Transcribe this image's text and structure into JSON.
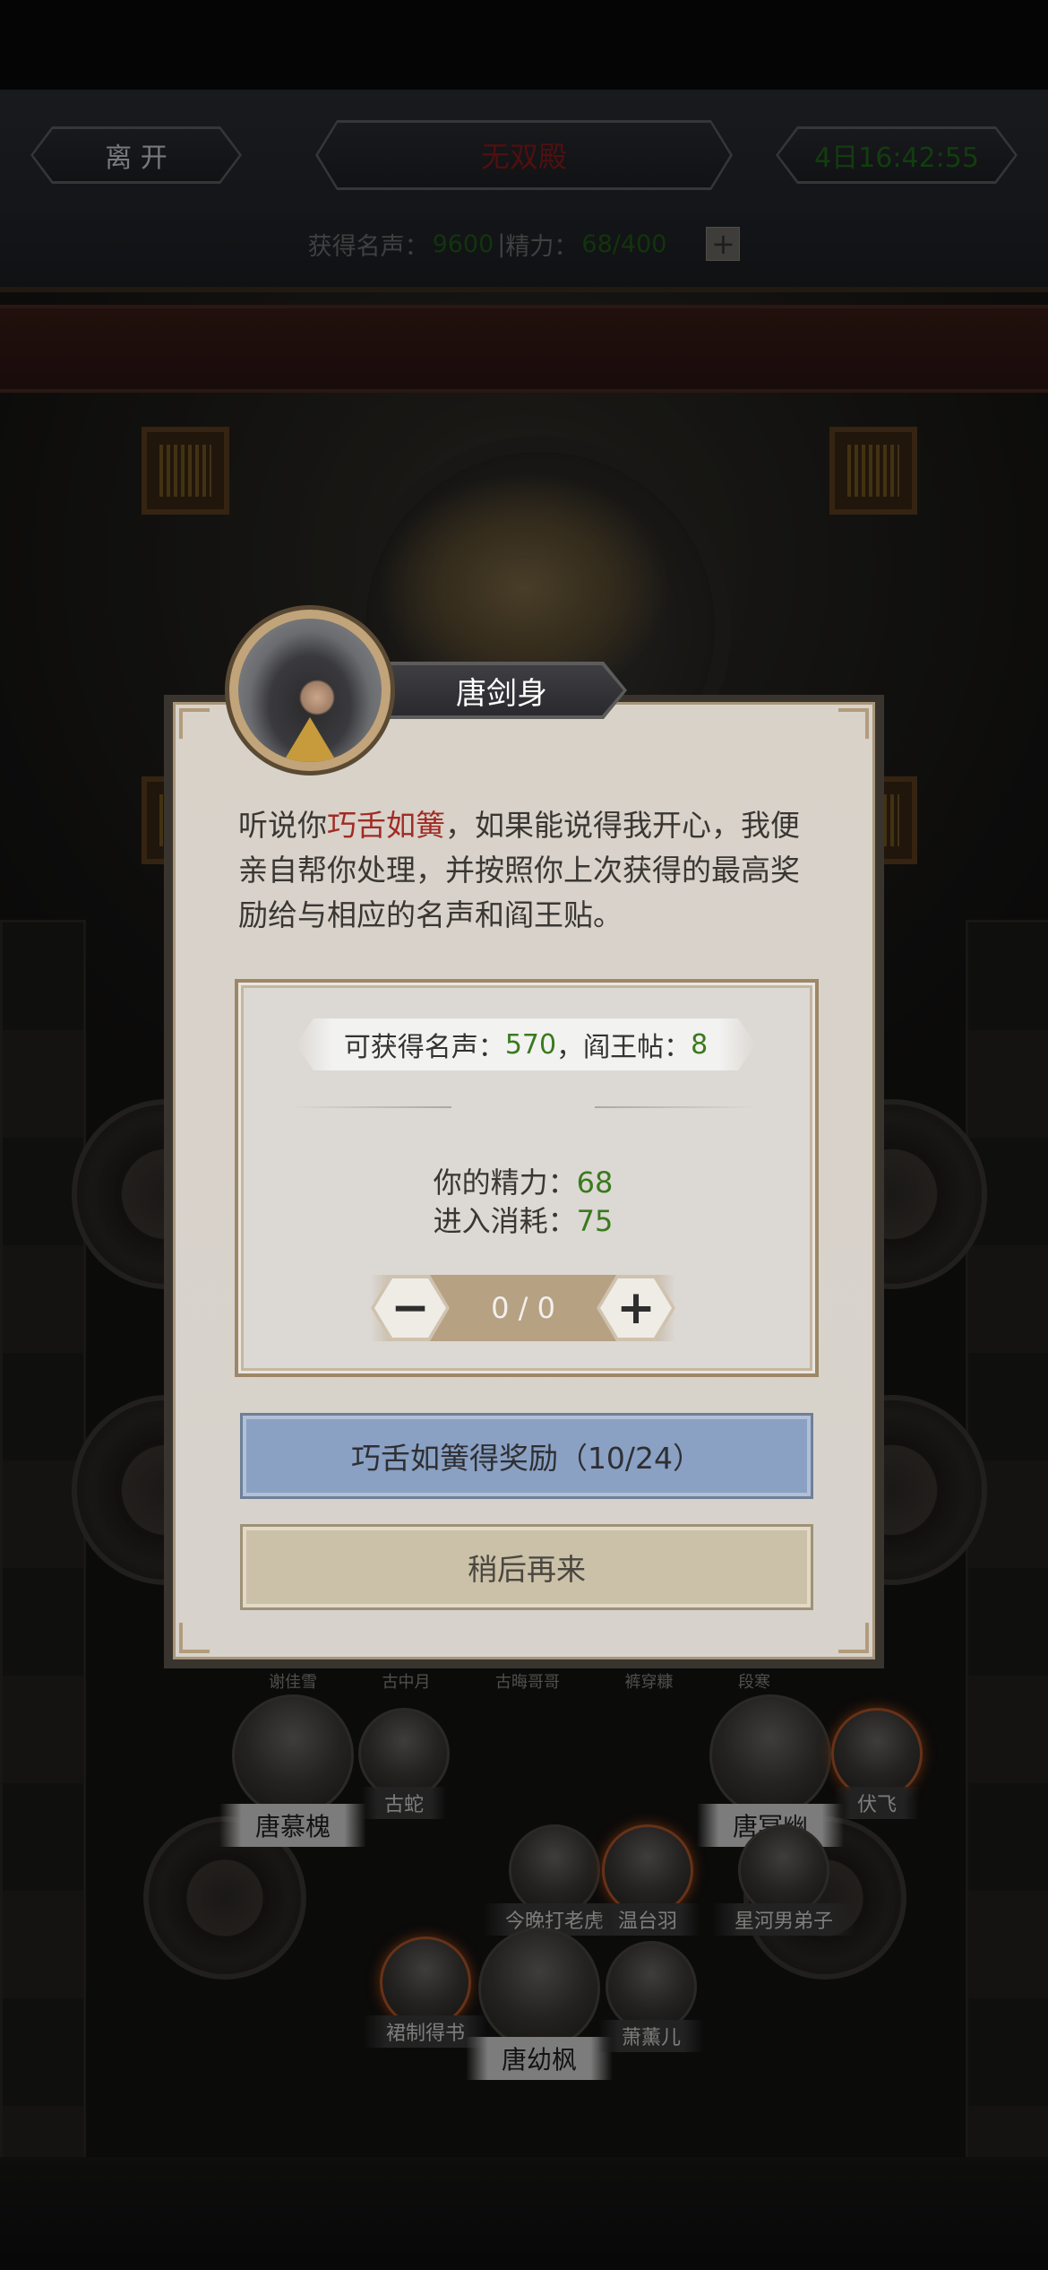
{
  "header": {
    "leave_label": "离 开",
    "title": "无双殿",
    "timer": "4日16:42:55",
    "fame_label": "获得名声：",
    "fame_value": "9600",
    "separator": "|",
    "energy_label": "精力：",
    "energy_value": "68/400",
    "add_symbol": "+"
  },
  "dialog": {
    "npc_name": "唐剑身",
    "text_before": "听说你",
    "text_highlight": "巧舌如簧",
    "text_after": "，如果能说得我开心，我便亲自帮你处理，并按照你上次获得的最高奖励给与相应的名声和阎王贴。",
    "reward_fame_label": "可获得名声：",
    "reward_fame_value": "570",
    "reward_sep": "，",
    "reward_ticket_label": "阎王帖：",
    "reward_ticket_value": "8",
    "energy_label": "你的精力：",
    "energy_value": "68",
    "cost_label": "进入消耗：",
    "cost_value": "75",
    "stepper_value": "0 / 0",
    "minus_symbol": "−",
    "plus_symbol": "+",
    "reward_button": "巧舌如簧得奖励（10/24）",
    "later_button": "稍后再来"
  },
  "scene": {
    "top_row_names": [
      "谢佳雪",
      "古中月",
      "古晦哥哥",
      "裤穿糠",
      "段寒"
    ],
    "characters": [
      {
        "name": "唐慕槐"
      },
      {
        "name": "古蛇"
      },
      {
        "name": "唐冥幽"
      },
      {
        "name": "伏飞"
      },
      {
        "name": "今晚打老虎"
      },
      {
        "name": "温台羽"
      },
      {
        "name": "星河男弟子"
      },
      {
        "name": "裙制得书"
      },
      {
        "name": "唐幼枫"
      },
      {
        "name": "萧薰儿"
      }
    ]
  },
  "colors": {
    "highlight_red": "#a22a24",
    "value_green": "#3a7a1e",
    "reward_button_blue": "#8aa1c4",
    "later_button_tan": "#cbc0a8"
  }
}
